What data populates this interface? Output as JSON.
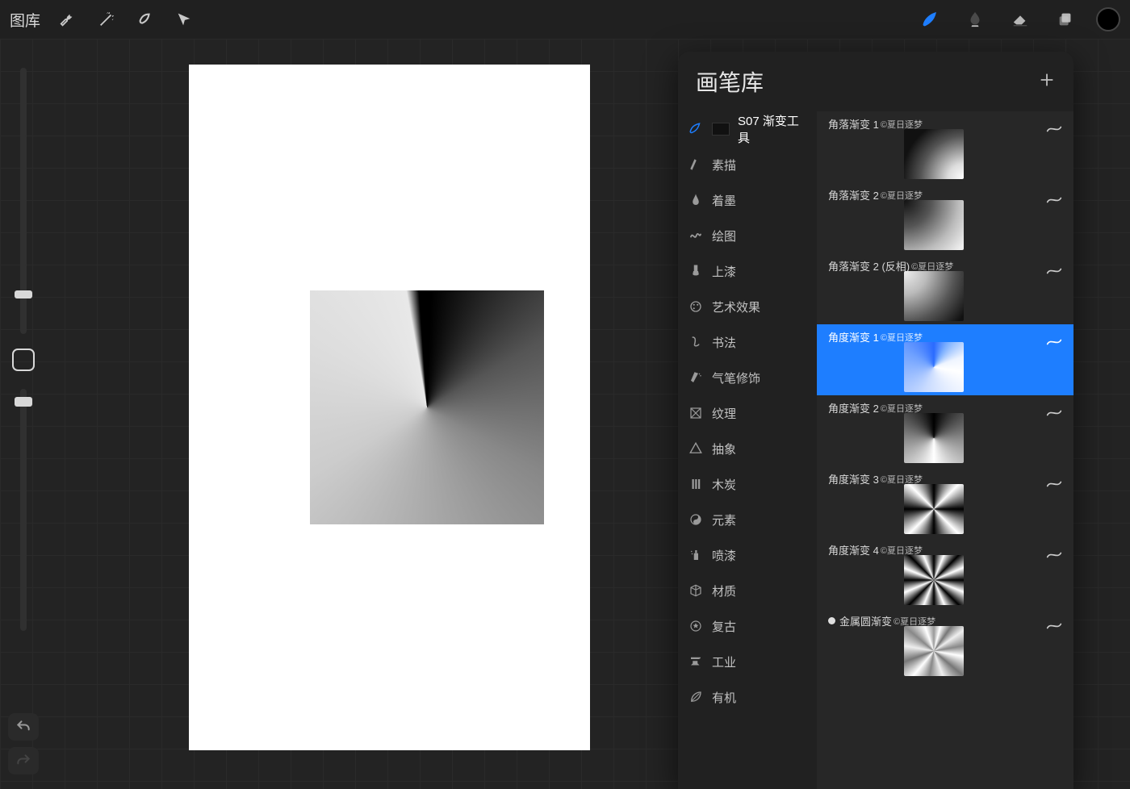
{
  "topbar": {
    "gallery": "图库"
  },
  "panel": {
    "title": "画笔库",
    "copyright_label": "©夏日逐梦"
  },
  "categories": [
    {
      "label": "S07 渐变工具",
      "icon": "recent",
      "active": true,
      "chip": true
    },
    {
      "label": "素描",
      "icon": "pencil"
    },
    {
      "label": "着墨",
      "icon": "pen"
    },
    {
      "label": "绘图",
      "icon": "squiggle"
    },
    {
      "label": "上漆",
      "icon": "brush"
    },
    {
      "label": "艺术效果",
      "icon": "palette"
    },
    {
      "label": "书法",
      "icon": "calligraphy"
    },
    {
      "label": "气笔修饰",
      "icon": "airbrush"
    },
    {
      "label": "纹理",
      "icon": "texture"
    },
    {
      "label": "抽象",
      "icon": "abstract"
    },
    {
      "label": "木炭",
      "icon": "charcoal"
    },
    {
      "label": "元素",
      "icon": "yinyang"
    },
    {
      "label": "喷漆",
      "icon": "spray"
    },
    {
      "label": "材质",
      "icon": "cube"
    },
    {
      "label": "复古",
      "icon": "star"
    },
    {
      "label": "工业",
      "icon": "anvil"
    },
    {
      "label": "有机",
      "icon": "leaf"
    }
  ],
  "brushes": [
    {
      "name": "角落渐变 1",
      "thumb": "th-corner1"
    },
    {
      "name": "角落渐变 2",
      "thumb": "th-corner2"
    },
    {
      "name": "角落渐变 2 (反相)",
      "thumb": "th-corner2inv"
    },
    {
      "name": "角度渐变 1",
      "thumb": "th-angle1",
      "selected": true
    },
    {
      "name": "角度渐变 2",
      "thumb": "th-angle2"
    },
    {
      "name": "角度渐变 3",
      "thumb": "th-angle3"
    },
    {
      "name": "角度渐变 4",
      "thumb": "th-angle4"
    },
    {
      "name": "金属圆渐变",
      "thumb": "th-metal",
      "dot": true
    }
  ]
}
